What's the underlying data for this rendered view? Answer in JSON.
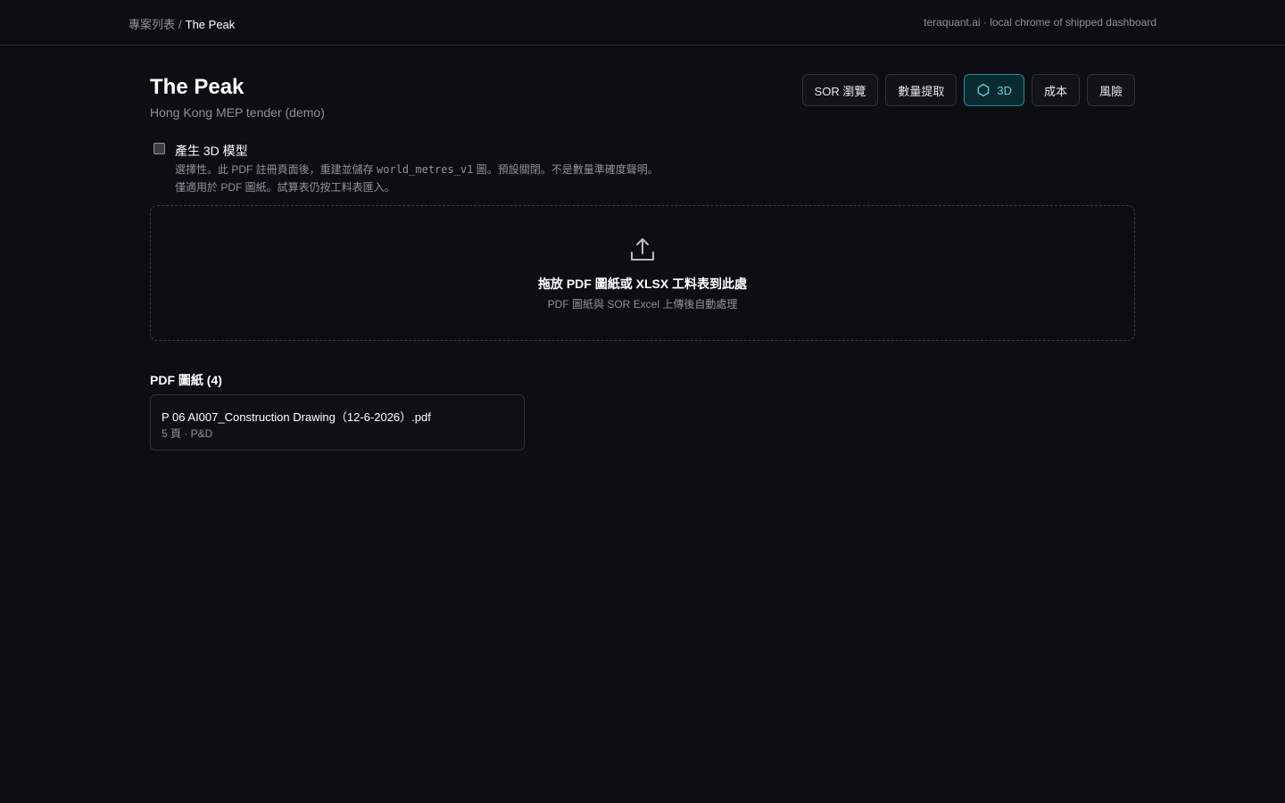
{
  "header": {
    "breadcrumb_root": "專案列表",
    "breadcrumb_sep": "/",
    "breadcrumb_current": "The Peak",
    "right_text": "teraquant.ai · local chrome of shipped dashboard"
  },
  "project": {
    "title": "The Peak",
    "subtitle": "Hong Kong MEP tender (demo)"
  },
  "toolbar": {
    "sor": "SOR 瀏覽",
    "qty": "數量提取",
    "three_d": "3D",
    "cost": "成本",
    "risk": "風險",
    "three_d_icon": "cube-icon",
    "active_color": "#5fd2dd"
  },
  "option_3d": {
    "checked": false,
    "label": "產生 3D 模型",
    "desc_prefix": "選擇性。此 PDF 註冊頁面後，重建並儲存 ",
    "desc_code": "world_metres_v1",
    "desc_suffix": " 圖。預設關閉。不是數量準確度聲明。",
    "desc_line2": "僅適用於 PDF 圖紙。試算表仍按工料表匯入。"
  },
  "dropzone": {
    "icon": "upload-icon",
    "title": "拖放 PDF 圖紙或 XLSX 工料表到此處",
    "subtitle": "PDF 圖紙與 SOR Excel 上傳後自動處理"
  },
  "pdf_section": {
    "title": "PDF 圖紙 (4)",
    "files": [
      {
        "name": "P 06 AI007_Construction Drawing（12-6-2026）.pdf",
        "meta": "5 頁 · P&D"
      }
    ]
  }
}
